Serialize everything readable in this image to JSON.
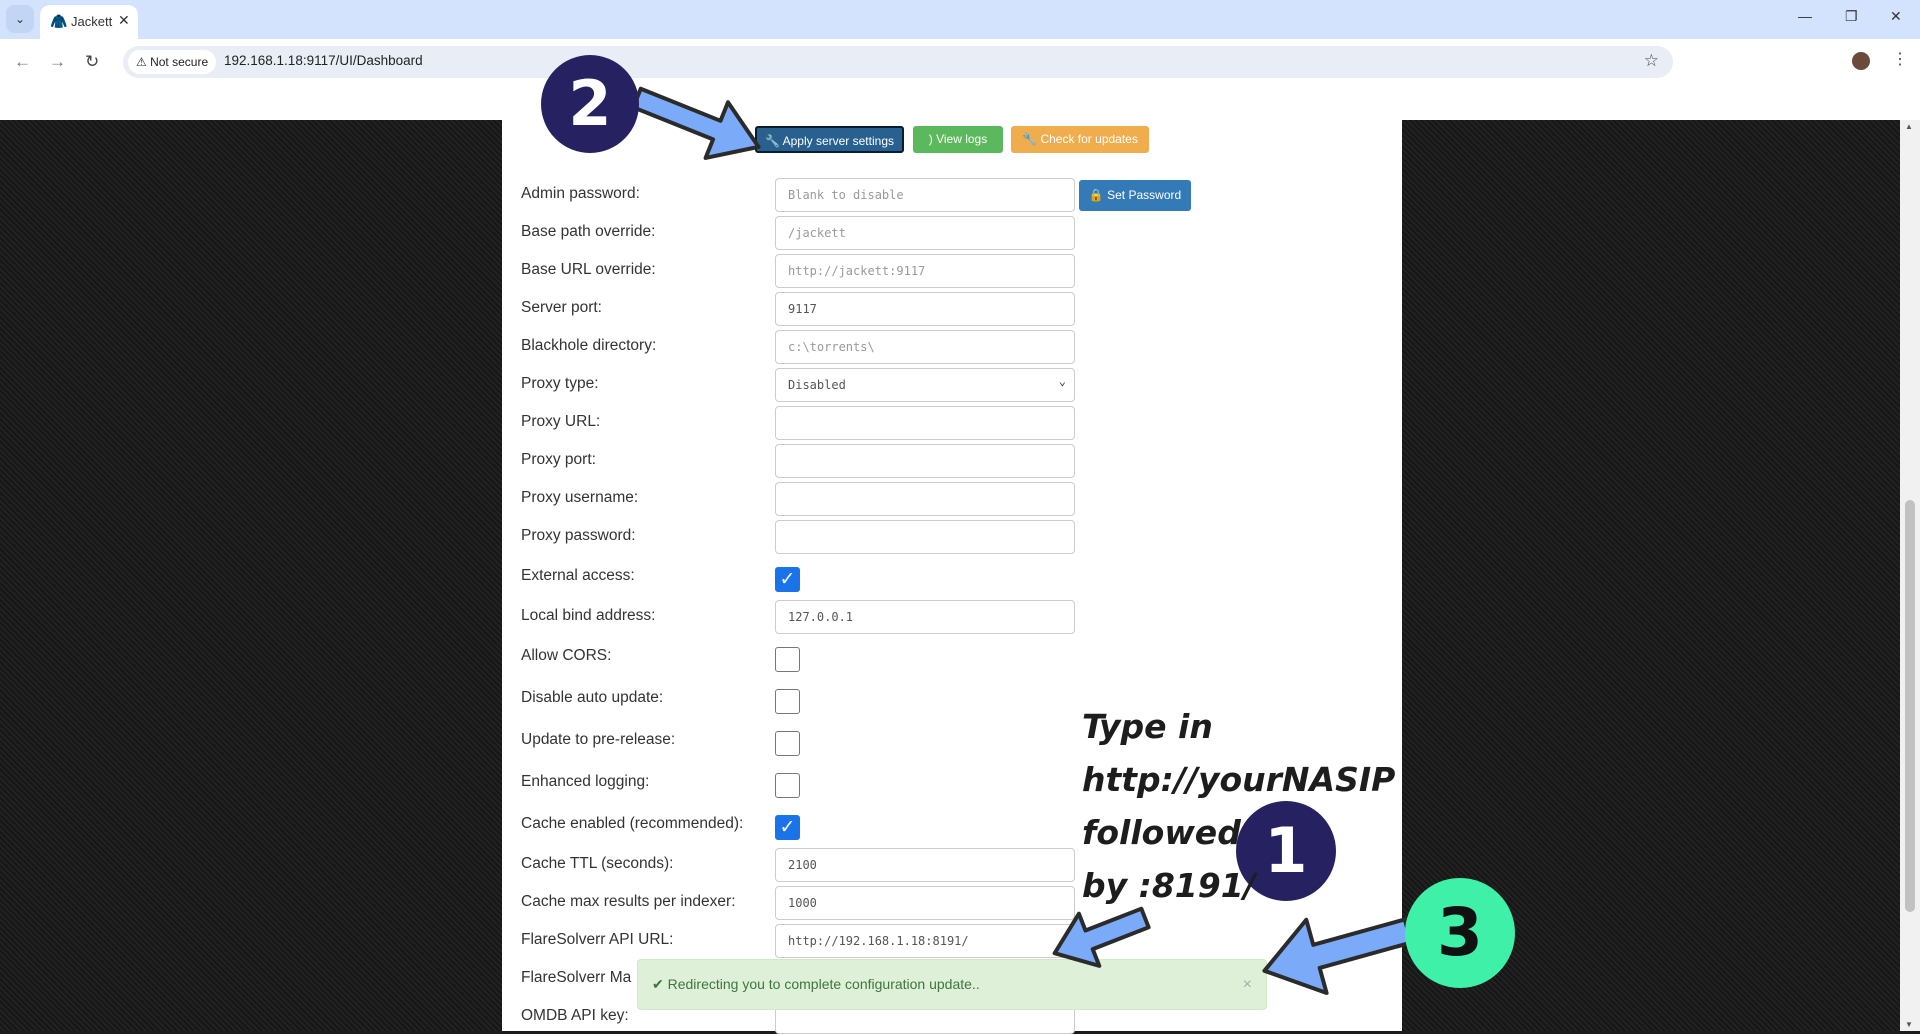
{
  "browser": {
    "tab_title": "Jackett",
    "url": "192.168.1.18:9117/UI/Dashboard",
    "security": "Not secure"
  },
  "toolbar": {
    "apply": "Apply server settings",
    "logs": "View logs",
    "updates": "Check for updates",
    "set_password": "Set Password"
  },
  "fields": [
    {
      "label": "Admin password:",
      "type": "text",
      "value": "",
      "placeholder": "Blank to disable"
    },
    {
      "label": "Base path override:",
      "type": "text",
      "value": "",
      "placeholder": "/jackett"
    },
    {
      "label": "Base URL override:",
      "type": "text",
      "value": "",
      "placeholder": "http://jackett:9117"
    },
    {
      "label": "Server port:",
      "type": "text",
      "value": "9117"
    },
    {
      "label": "Blackhole directory:",
      "type": "text",
      "value": "",
      "placeholder": "c:\\torrents\\"
    },
    {
      "label": "Proxy type:",
      "type": "select",
      "value": "Disabled"
    },
    {
      "label": "Proxy URL:",
      "type": "text",
      "value": ""
    },
    {
      "label": "Proxy port:",
      "type": "text",
      "value": ""
    },
    {
      "label": "Proxy username:",
      "type": "text",
      "value": ""
    },
    {
      "label": "Proxy password:",
      "type": "text",
      "value": ""
    },
    {
      "label": "External access:",
      "type": "checkbox",
      "checked": true
    },
    {
      "label": "Local bind address:",
      "type": "text",
      "value": "127.0.0.1"
    },
    {
      "label": "Allow CORS:",
      "type": "checkbox",
      "checked": false
    },
    {
      "label": "Disable auto update:",
      "type": "checkbox",
      "checked": false
    },
    {
      "label": "Update to pre-release:",
      "type": "checkbox",
      "checked": false
    },
    {
      "label": "Enhanced logging:",
      "type": "checkbox",
      "checked": false
    },
    {
      "label": "Cache enabled (recommended):",
      "type": "checkbox",
      "checked": true
    },
    {
      "label": "Cache TTL (seconds):",
      "type": "text",
      "value": "2100"
    },
    {
      "label": "Cache max results per indexer:",
      "type": "text",
      "value": "1000"
    },
    {
      "label": "FlareSolverr API URL:",
      "type": "text",
      "value": "http://192.168.1.18:8191/"
    },
    {
      "label": "FlareSolverr Ma",
      "type": "text",
      "value": ""
    },
    {
      "label": "OMDB API key:",
      "type": "text",
      "value": ""
    }
  ],
  "alert": {
    "text": "Redirecting you to complete configuration update..",
    "close": "×"
  },
  "annotations": {
    "step1": "1",
    "step2": "2",
    "step3": "3",
    "note_lines": [
      "Type in",
      "http://yourNASIP",
      "followed",
      "by :8191/"
    ]
  },
  "colors": {
    "apply": "#286090",
    "logs": "#5cb85c",
    "updates": "#f0ad4e",
    "set_password": "#337ab7",
    "arrow": "#7aaaf8",
    "step12": "#262262",
    "step3": "#3ef0a8"
  }
}
